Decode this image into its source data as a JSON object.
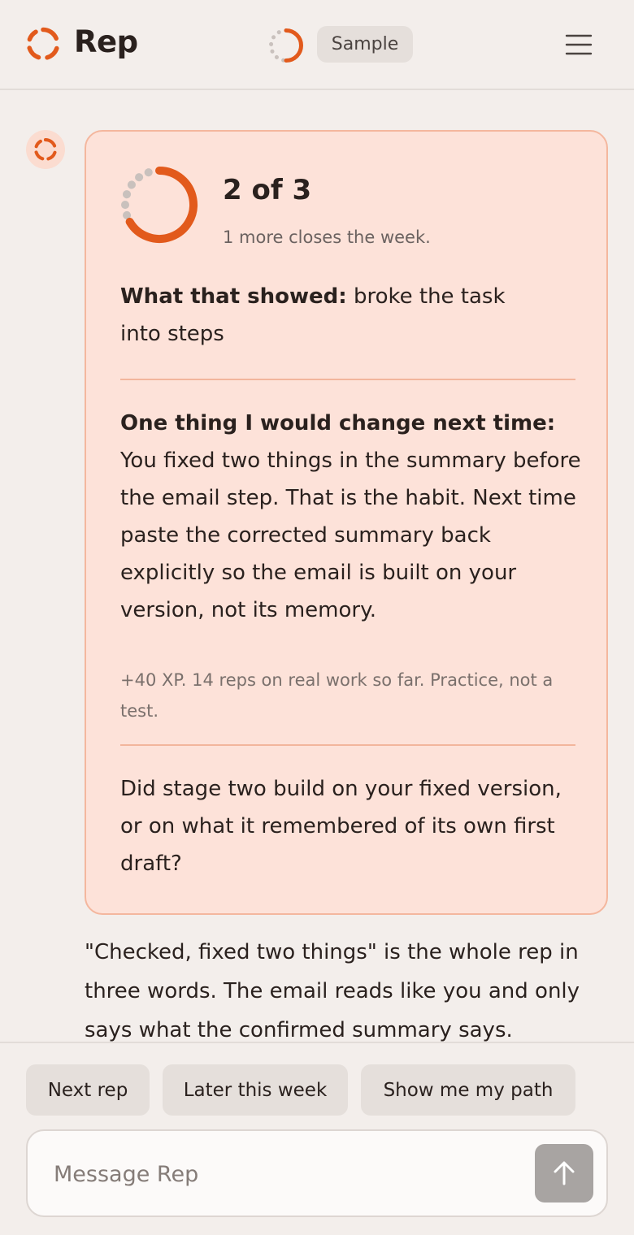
{
  "header": {
    "app_name": "Rep",
    "badge": "Sample",
    "logo_icon": "ring-logo-icon",
    "menu_icon": "hamburger-menu-icon"
  },
  "progress": {
    "completed": 2,
    "total": 3,
    "title": "2 of 3",
    "subtitle": "1 more closes the week."
  },
  "card": {
    "showed_label": "What that showed:",
    "showed_text": " broke the task into steps",
    "change_label": "One thing I would change next time:",
    "change_text": " You fixed two things in the summary before the email step. That is the habit. Next time paste the corrected summary back explicitly so the email is built on your version, not its memory.",
    "xp_note": "+40 XP. 14 reps on real work so far. Practice, not a test.",
    "question": "Did stage two build on your fixed version, or on what it remembered of its own first draft?"
  },
  "reply": "\"Checked, fixed two things\" is the whole rep in three words. The email reads like you and only says what the confirmed summary says.",
  "quick_replies": [
    "Next rep",
    "Later this week",
    "Show me my path"
  ],
  "composer": {
    "placeholder": "Message Rep",
    "send_icon": "arrow-up-icon"
  },
  "colors": {
    "accent": "#e25a1c",
    "progress_muted": "#c9c1bd",
    "card_bg": "#fde2d9",
    "card_border": "#f4b79e"
  }
}
